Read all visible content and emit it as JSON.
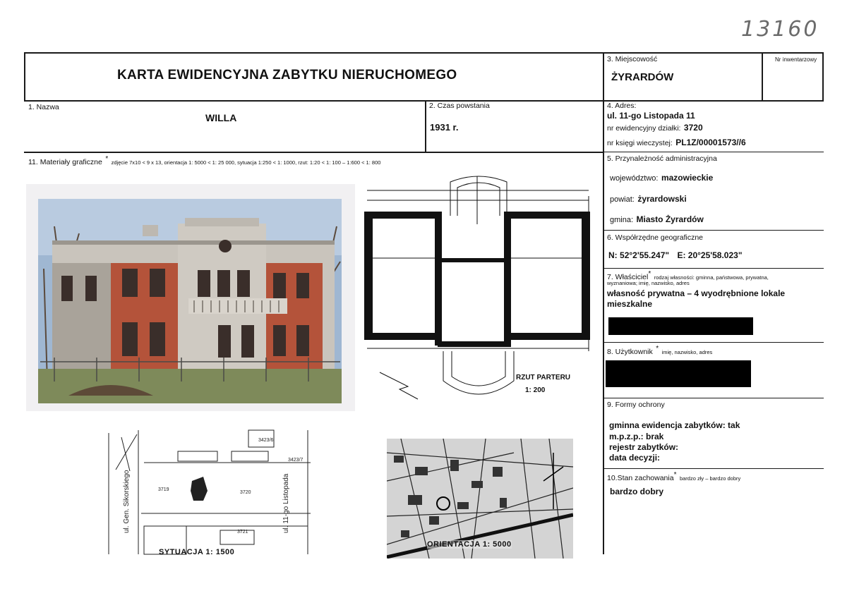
{
  "handwritten_number": "13160",
  "title": "KARTA EWIDENCYJNA ZABYTKU NIERUCHOMEGO",
  "field3": {
    "label": "3. Miejscowość",
    "value": "ŻYRARDÓW"
  },
  "inventory_no": {
    "label": "Nr inwentarzowy"
  },
  "field1": {
    "label": "1. Nazwa",
    "value": "WILLA"
  },
  "field2": {
    "label": "2. Czas powstania",
    "value": "1931 r."
  },
  "field4": {
    "label": "4. Adres:",
    "street": "ul. 11-go Listopada 11",
    "plot_label": "nr ewidencyjny działki:",
    "plot_value": "3720",
    "book_label": "nr księgi wieczystej:",
    "book_value": "PL1Z/00001573//6"
  },
  "field11": {
    "label": "11. Materiały graficzne",
    "asterisk": "*",
    "note": "zdjęcie 7x10 < 9 x 13, orientacja 1: 5000 < 1: 25 000, sytuacja 1:250 < 1: 1000, rzut: 1:20 < 1: 100 – 1:600 < 1: 800"
  },
  "field5": {
    "label": "5. Przynależność administracyjna",
    "voivodeship_label": "województwo:",
    "voivodeship_value": "mazowieckie",
    "county_label": "powiat:",
    "county_value": "żyrardowski",
    "commune_label": "gmina:",
    "commune_value": "Miasto Żyrardów"
  },
  "field6": {
    "label": "6. Współrzędne geograficzne",
    "n_label": "N:",
    "n_value": "52°2'55.247\"",
    "e_label": "E:",
    "e_value": "20°25'58.023\""
  },
  "field7": {
    "label": "7. Właściciel",
    "asterisk": "*",
    "note_line1": "rodzaj własności: gminna, państwowa, prywatna,",
    "note_line2": "wyznaniowa; imię, nazwisko, adres",
    "value_line1": "własność prywatna – 4 wyodrębnione lokale",
    "value_line2": "mieszkalne"
  },
  "field8": {
    "label": "8. Użytkownik",
    "asterisk": "*",
    "note": "imię, nazwisko, adres"
  },
  "field9": {
    "label": "9. Formy ochrony",
    "line1": "gminna ewidencja zabytków:  tak",
    "line2": "m.p.z.p.: brak",
    "line3": "rejestr zabytków:",
    "line4": "data decyzji:"
  },
  "field10": {
    "label": "10.Stan zachowania",
    "asterisk": "*",
    "note": "bardzo zły – bardzo dobry",
    "value": "bardzo dobry"
  },
  "plan": {
    "title": "RZUT PARTERU",
    "scale": "1: 200"
  },
  "situation": {
    "caption": "SYTUACJA 1: 1500"
  },
  "orientation": {
    "caption": "ORIENTACJA 1: 5000"
  },
  "colors": {
    "ink": "#1a1a1a",
    "redaction": "#000000",
    "brick": "#b4533a",
    "sky": "#9fb7d2"
  }
}
